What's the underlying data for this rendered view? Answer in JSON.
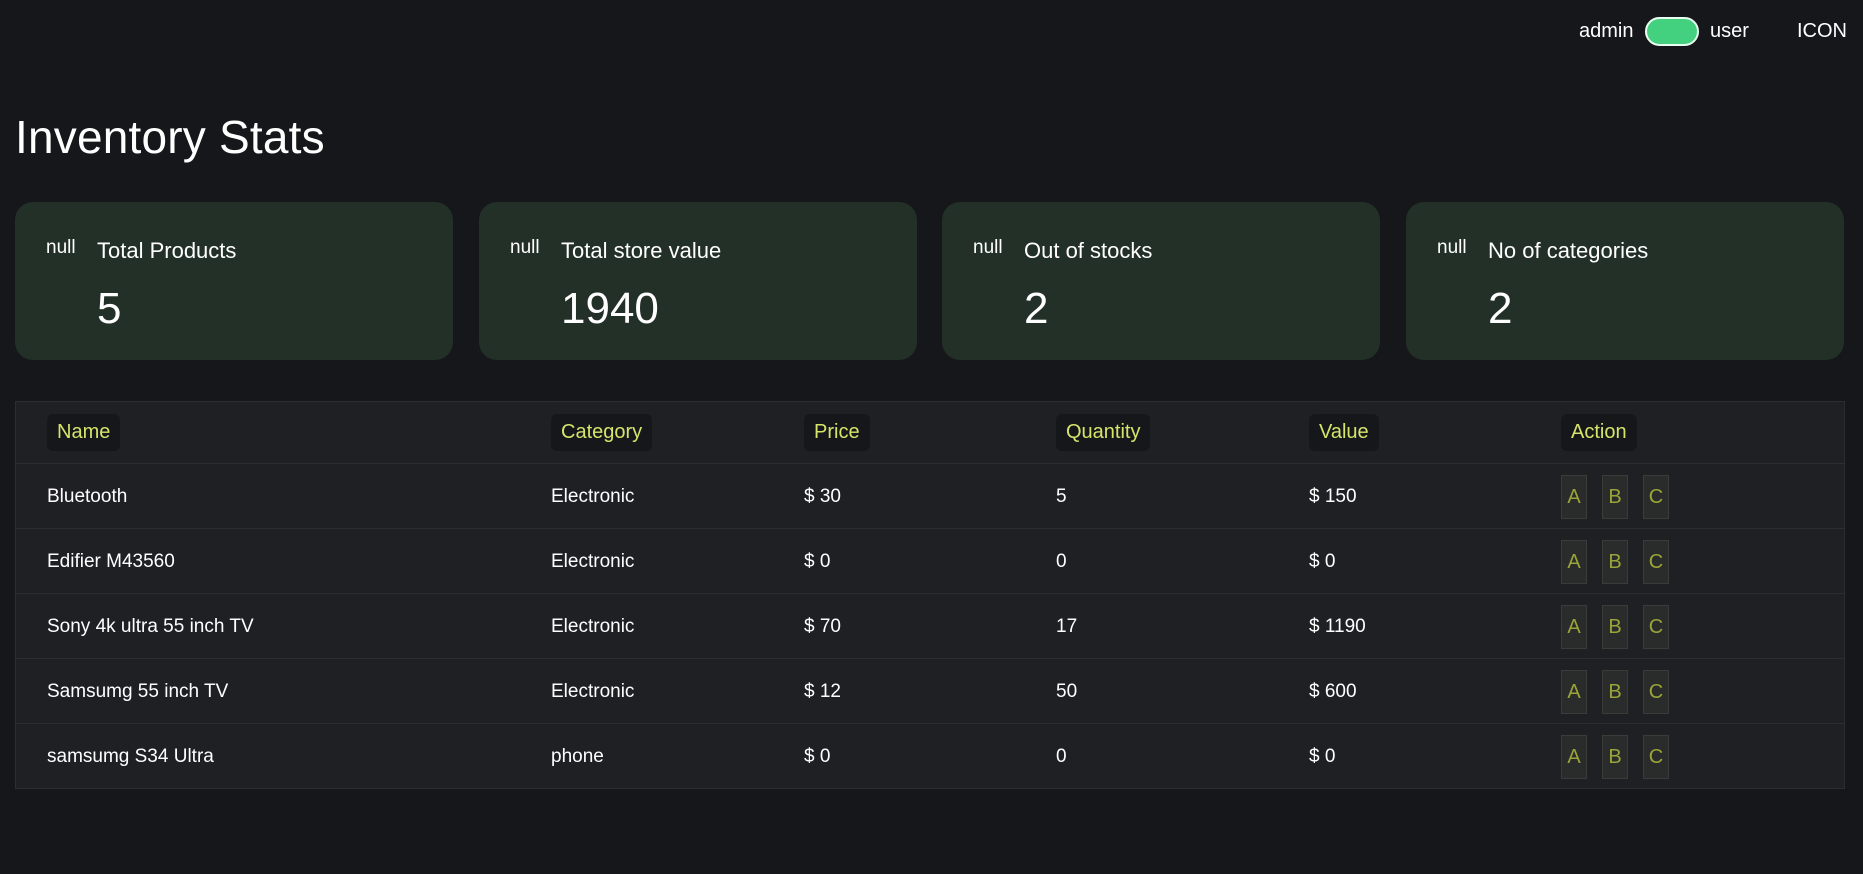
{
  "topbar": {
    "admin_label": "admin",
    "user_label": "user",
    "icon_text": "ICON",
    "toggle_color": "#44d17f"
  },
  "page": {
    "title": "Inventory Stats"
  },
  "cards": [
    {
      "icon": "null",
      "label": "Total Products",
      "value": "5"
    },
    {
      "icon": "null",
      "label": "Total store value",
      "value": "1940"
    },
    {
      "icon": "null",
      "label": "Out of stocks",
      "value": "2"
    },
    {
      "icon": "null",
      "label": "No of categories",
      "value": "2"
    }
  ],
  "table": {
    "headers": [
      "Name",
      "Category",
      "Price",
      "Quantity",
      "Value",
      "Action"
    ],
    "rows": [
      {
        "name": "Bluetooth",
        "category": "Electronic",
        "price": "$ 30",
        "quantity": "5",
        "value": "$ 150"
      },
      {
        "name": "Edifier M43560",
        "category": "Electronic",
        "price": "$ 0",
        "quantity": "0",
        "value": "$ 0"
      },
      {
        "name": "Sony 4k ultra 55 inch TV",
        "category": "Electronic",
        "price": "$ 70",
        "quantity": "17",
        "value": "$ 1190"
      },
      {
        "name": "Samsumg 55 inch TV",
        "category": "Electronic",
        "price": "$ 12",
        "quantity": "50",
        "value": "$ 600"
      },
      {
        "name": "samsumg S34 Ultra",
        "category": "phone",
        "price": "$ 0",
        "quantity": "0",
        "value": "$ 0"
      }
    ],
    "action_labels": [
      "A",
      "B",
      "C"
    ]
  },
  "colors": {
    "background": "#16171a",
    "card": "#233027",
    "table": "#1f2024",
    "header_text": "#d6e46a",
    "action_text": "#9aa438"
  }
}
